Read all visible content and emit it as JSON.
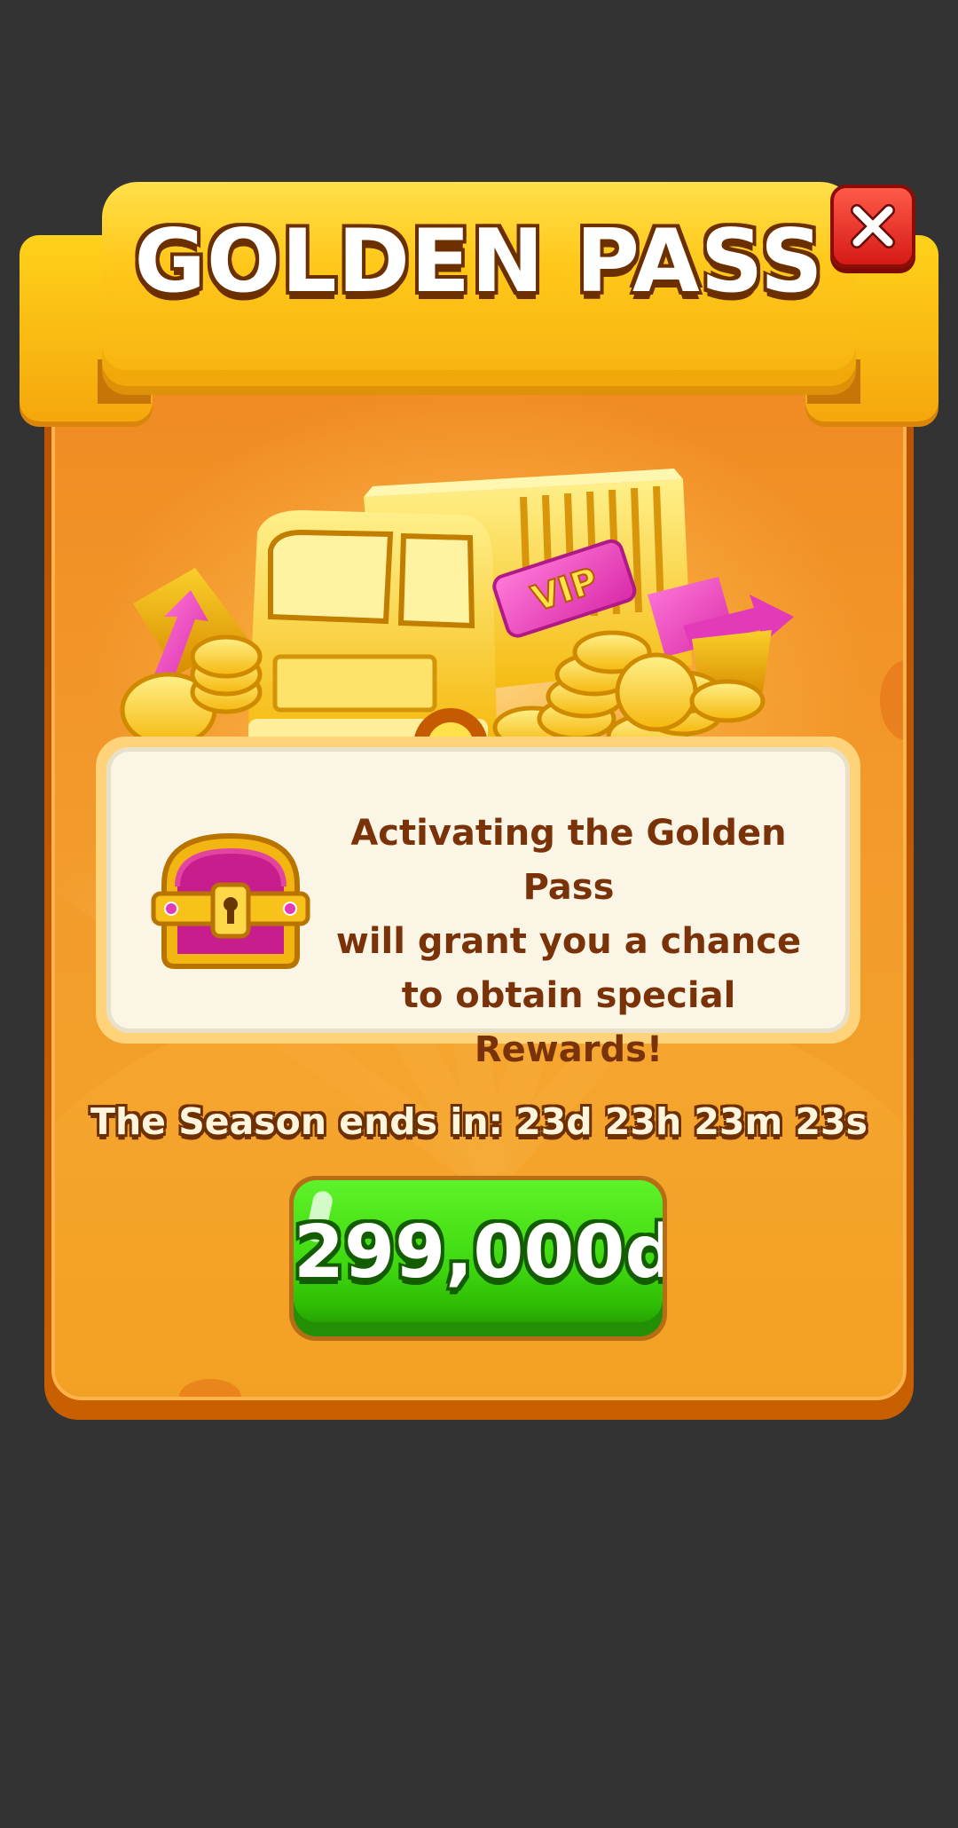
{
  "popup": {
    "title": "GOLDEN PASS",
    "description": "Activating the Golden Pass\nwill grant you a chance\nto obtain special Rewards!",
    "vip_label": "VIP",
    "timer": "The Season ends in: 23d 23h 23m 23s",
    "price_label": "299,000d"
  },
  "icons": {
    "close": "close-icon",
    "truck": "golden-truck-icon",
    "chest": "treasure-chest-icon",
    "coins": "gold-coins-icon"
  },
  "colors": {
    "backdrop": "#333333",
    "panel": "#f39a2c",
    "ribbon": "#ffc81a",
    "close_button": "#d51a14",
    "buy_button": "#3fd80f",
    "text_brown": "#7a3208"
  }
}
